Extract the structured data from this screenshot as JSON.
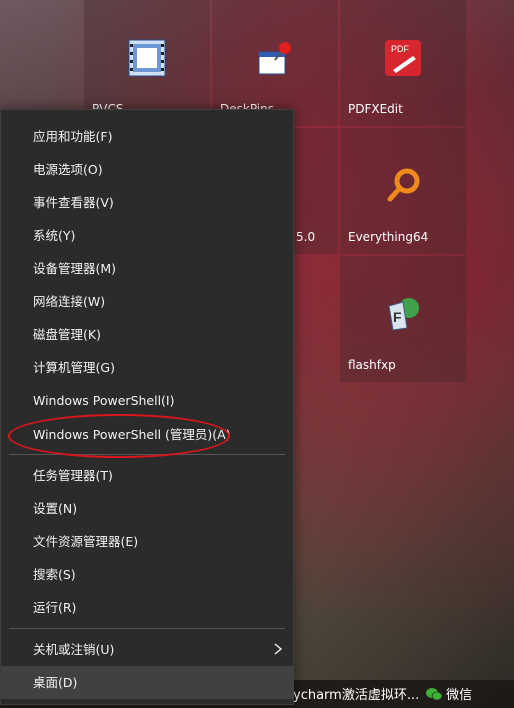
{
  "tiles": {
    "row1": [
      {
        "label": "PVCS",
        "icon": "film-icon"
      },
      {
        "label": "DeskPins",
        "icon": "pushpin-icon"
      },
      {
        "label": "PDFXEdit",
        "icon": "pdf-icon"
      }
    ],
    "row2": [
      {
        "label": "5.0",
        "icon": ""
      },
      {
        "label": "Everything64",
        "icon": "magnifier-icon"
      }
    ],
    "row3": [
      {
        "label": "flashfxp",
        "icon": "flashfxp-icon"
      }
    ]
  },
  "menu": {
    "items": [
      {
        "label": "应用和功能(F)"
      },
      {
        "label": "电源选项(O)"
      },
      {
        "label": "事件查看器(V)"
      },
      {
        "label": "系统(Y)"
      },
      {
        "label": "设备管理器(M)"
      },
      {
        "label": "网络连接(W)"
      },
      {
        "label": "磁盘管理(K)"
      },
      {
        "label": "计算机管理(G)"
      },
      {
        "label": "Windows PowerShell(I)"
      },
      {
        "label": "Windows PowerShell (管理员)(A)"
      },
      {
        "label": "任务管理器(T)"
      },
      {
        "label": "设置(N)"
      },
      {
        "label": "文件资源管理器(E)"
      },
      {
        "label": "搜索(S)"
      },
      {
        "label": "运行(R)"
      },
      {
        "label": "关机或注销(U)"
      },
      {
        "label": "桌面(D)"
      }
    ],
    "highlighted_item": "Windows PowerShell (管理员)(A)",
    "highlight_color": "#d9161c"
  },
  "taskbar": {
    "items": [
      {
        "label": "ycharm激活虚拟环..."
      },
      {
        "label": "微信"
      }
    ]
  },
  "colors": {
    "menu_bg": "#2b2b2b",
    "menu_text": "#f2f2f2",
    "menu_selected": "#414141"
  }
}
